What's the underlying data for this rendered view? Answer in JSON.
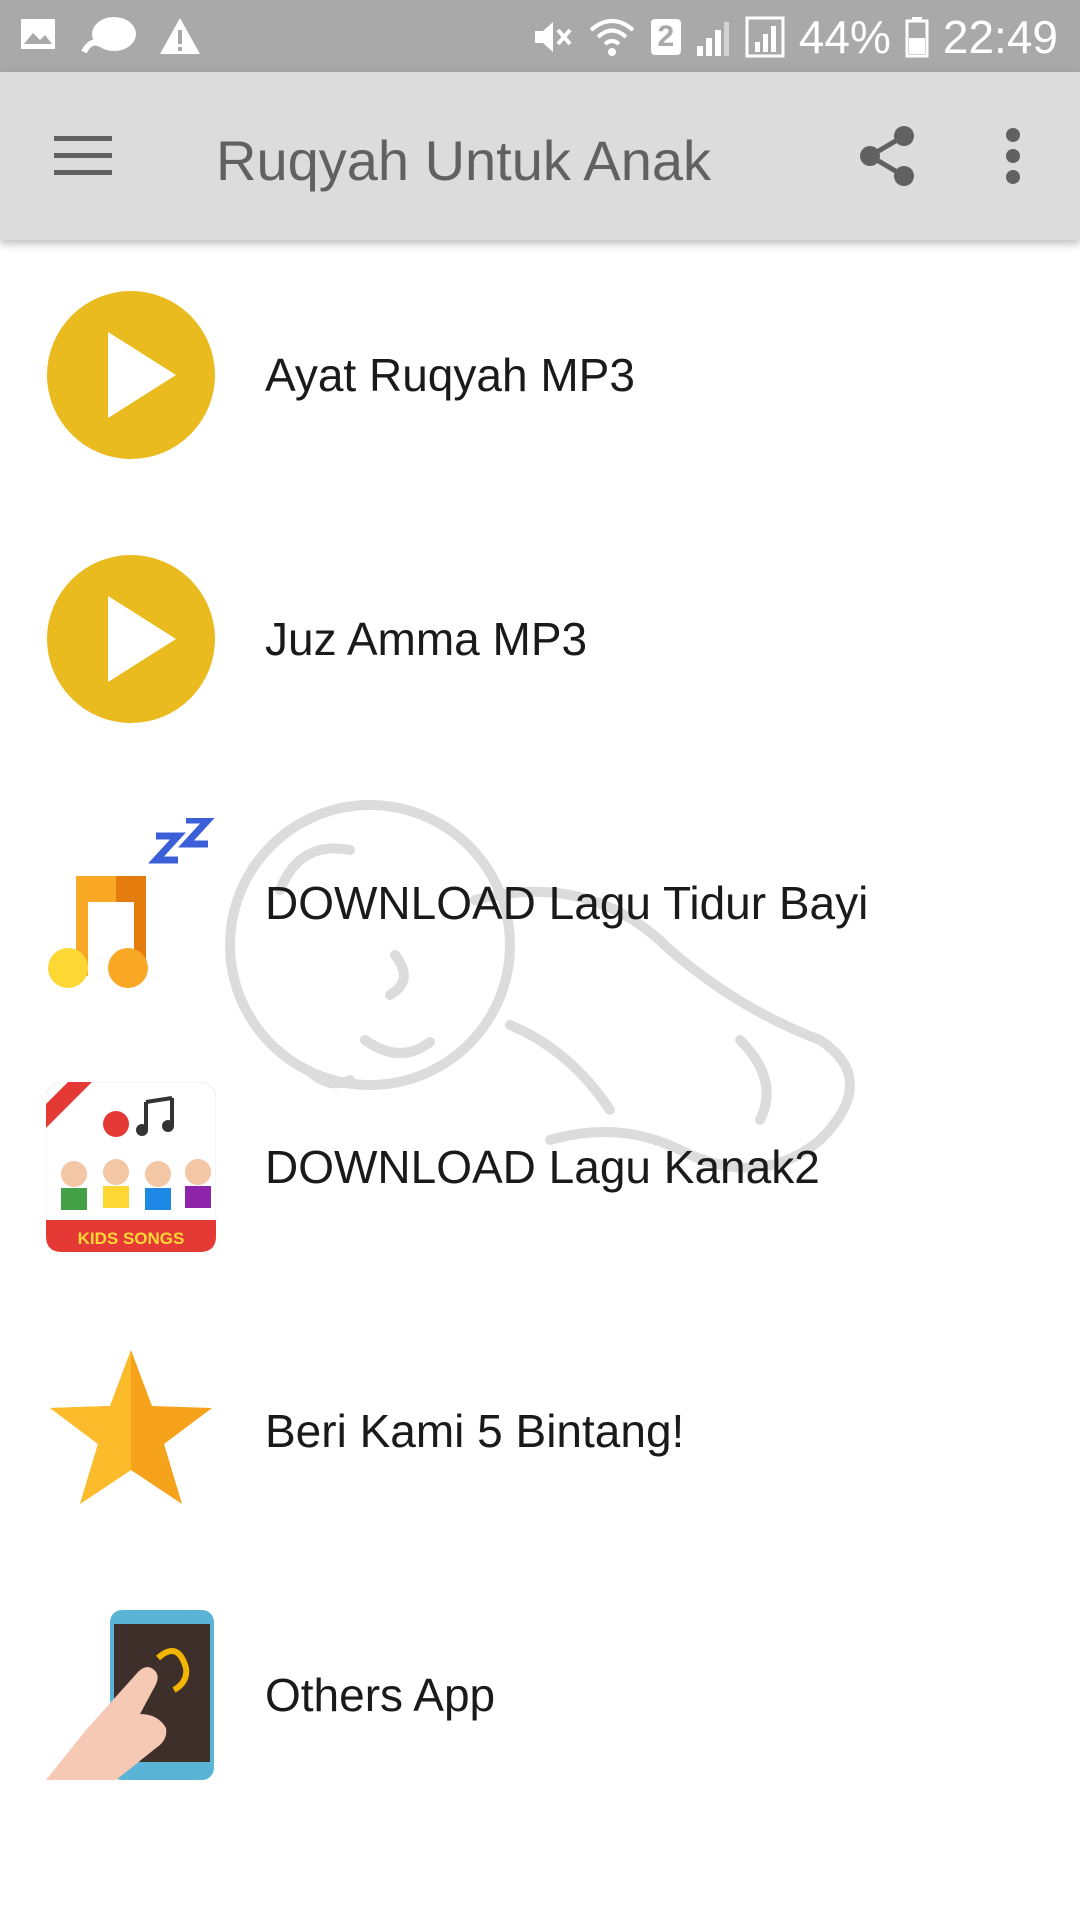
{
  "status_bar": {
    "battery": "44%",
    "time": "22:49",
    "sim_badge": "2",
    "icons_left": [
      "image-icon",
      "chat-icon",
      "warning-icon"
    ],
    "icons_right": [
      "mute-icon",
      "wifi-icon",
      "signal-icon",
      "signal-icon",
      "battery-icon"
    ]
  },
  "app_bar": {
    "title": "Ruqyah Untuk Anak",
    "icons": [
      "menu-icon",
      "share-icon",
      "more-vert-icon"
    ],
    "background": "#dcdcdc"
  },
  "menu": {
    "items": [
      {
        "label": "Ayat Ruqyah MP3",
        "icon": "play-icon"
      },
      {
        "label": "Juz Amma MP3",
        "icon": "play-icon"
      },
      {
        "label": "DOWNLOAD Lagu Tidur Bayi",
        "icon": "music-sleep-icon"
      },
      {
        "label": "DOWNLOAD Lagu Kanak2",
        "icon": "kids-songs-icon"
      },
      {
        "label": "Beri Kami 5 Bintang!",
        "icon": "star-icon"
      },
      {
        "label": "Others App",
        "icon": "phone-tap-icon"
      }
    ],
    "kids_badge": "KIDS SONGS"
  },
  "colors": {
    "play_yellow": "#e9bb1f",
    "accent_orange": "#f7a21b"
  }
}
